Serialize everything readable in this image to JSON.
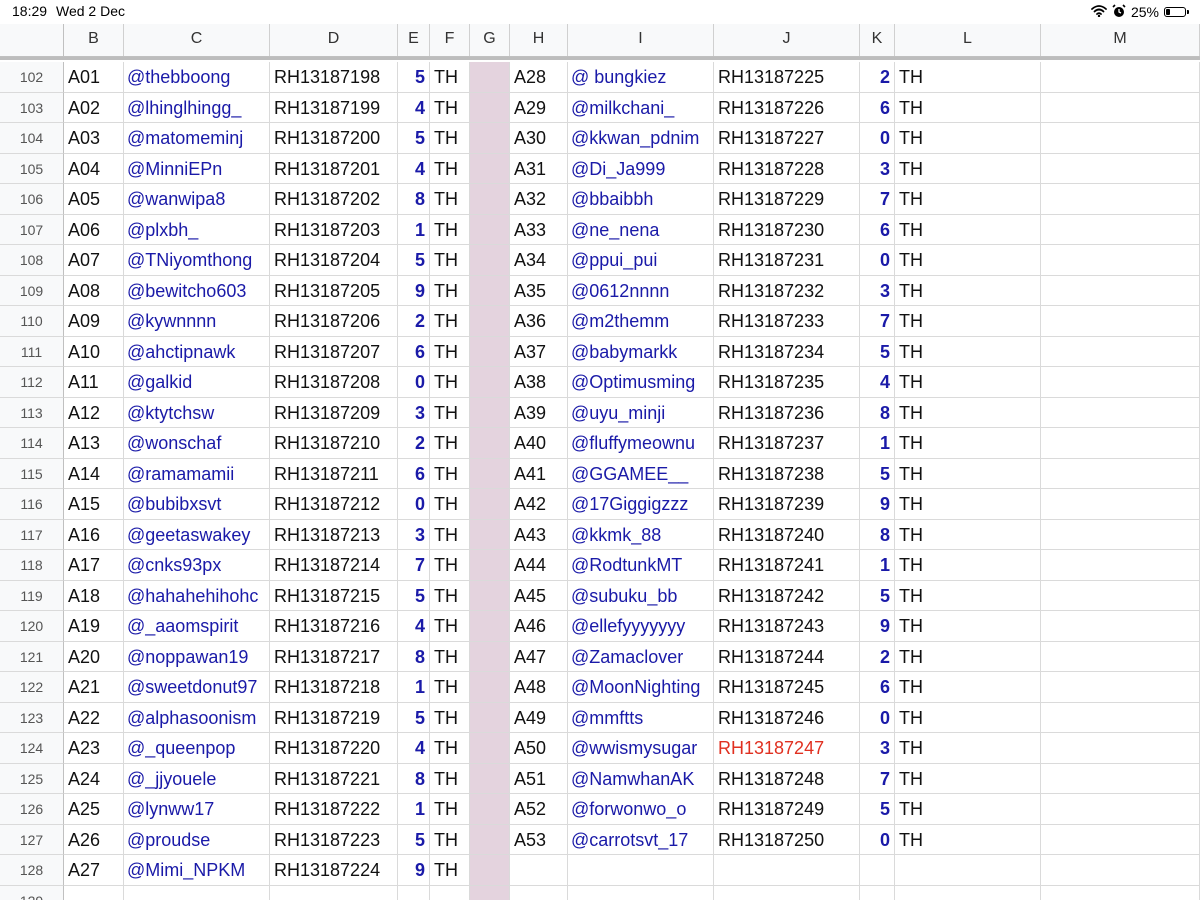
{
  "status_bar": {
    "time": "18:29",
    "date": "Wed 2 Dec",
    "battery": "25%",
    "battery_level": 0.25,
    "icons": [
      "wifi-icon",
      "alarm-icon",
      "battery-icon"
    ]
  },
  "colors": {
    "handle_text": "#1a1aa8",
    "highlight_text": "#e03020",
    "g_column_fill": "#e4d3de"
  },
  "columns": [
    "B",
    "C",
    "D",
    "E",
    "F",
    "G",
    "H",
    "I",
    "J",
    "K",
    "L",
    "M"
  ],
  "rows": [
    {
      "n": "102",
      "b": "A01",
      "c": "@thebboong",
      "d": "RH13187198",
      "e": "5",
      "f": "TH",
      "h": "A28",
      "i": "@ bungkiez",
      "j": "RH13187225",
      "k": "2",
      "l": "TH"
    },
    {
      "n": "103",
      "b": "A02",
      "c": "@lhinglhingg_",
      "d": "RH13187199",
      "e": "4",
      "f": "TH",
      "h": "A29",
      "i": "@milkchani_",
      "j": "RH13187226",
      "k": "6",
      "l": "TH"
    },
    {
      "n": "104",
      "b": "A03",
      "c": "@matomeminj",
      "d": "RH13187200",
      "e": "5",
      "f": "TH",
      "h": "A30",
      "i": "@kkwan_pdnim",
      "j": "RH13187227",
      "k": "0",
      "l": "TH"
    },
    {
      "n": "105",
      "b": "A04",
      "c": "@MinniEPn",
      "d": "RH13187201",
      "e": "4",
      "f": "TH",
      "h": "A31",
      "i": "@Di_Ja999",
      "j": "RH13187228",
      "k": "3",
      "l": "TH"
    },
    {
      "n": "106",
      "b": "A05",
      "c": "@wanwipa8",
      "d": "RH13187202",
      "e": "8",
      "f": "TH",
      "h": "A32",
      "i": "@bbaibbh",
      "j": "RH13187229",
      "k": "7",
      "l": "TH"
    },
    {
      "n": "107",
      "b": "A06",
      "c": "@plxbh_",
      "d": "RH13187203",
      "e": "1",
      "f": "TH",
      "h": "A33",
      "i": "@ne_nena",
      "j": "RH13187230",
      "k": "6",
      "l": "TH"
    },
    {
      "n": "108",
      "b": "A07",
      "c": "@TNiyomthong",
      "d": "RH13187204",
      "e": "5",
      "f": "TH",
      "h": "A34",
      "i": "@ppui_pui",
      "j": "RH13187231",
      "k": "0",
      "l": "TH"
    },
    {
      "n": "109",
      "b": "A08",
      "c": "@bewitcho603",
      "d": "RH13187205",
      "e": "9",
      "f": "TH",
      "h": "A35",
      "i": "@0612nnnn",
      "j": "RH13187232",
      "k": "3",
      "l": "TH"
    },
    {
      "n": "110",
      "b": "A09",
      "c": "@kywnnnn",
      "d": "RH13187206",
      "e": "2",
      "f": "TH",
      "h": "A36",
      "i": "@m2themm",
      "j": "RH13187233",
      "k": "7",
      "l": "TH"
    },
    {
      "n": "111",
      "b": "A10",
      "c": "@ahctipnawk",
      "d": "RH13187207",
      "e": "6",
      "f": "TH",
      "h": "A37",
      "i": "@babymarkk",
      "j": "RH13187234",
      "k": "5",
      "l": "TH"
    },
    {
      "n": "112",
      "b": "A11",
      "c": "@galkid",
      "d": "RH13187208",
      "e": "0",
      "f": "TH",
      "h": "A38",
      "i": "@Optimusming",
      "j": "RH13187235",
      "k": "4",
      "l": "TH"
    },
    {
      "n": "113",
      "b": "A12",
      "c": "@ktytchsw",
      "d": "RH13187209",
      "e": "3",
      "f": "TH",
      "h": "A39",
      "i": "@uyu_minji",
      "j": "RH13187236",
      "k": "8",
      "l": "TH"
    },
    {
      "n": "114",
      "b": "A13",
      "c": "@wonschaf",
      "d": "RH13187210",
      "e": "2",
      "f": "TH",
      "h": "A40",
      "i": "@fluffymeownu",
      "j": "RH13187237",
      "k": "1",
      "l": "TH"
    },
    {
      "n": "115",
      "b": "A14",
      "c": "@ramamamii",
      "d": "RH13187211",
      "e": "6",
      "f": "TH",
      "h": "A41",
      "i": "@GGAMEE__",
      "j": "RH13187238",
      "k": "5",
      "l": "TH"
    },
    {
      "n": "116",
      "b": "A15",
      "c": "@bubibxsvt",
      "d": "RH13187212",
      "e": "0",
      "f": "TH",
      "h": "A42",
      "i": "@17Giggigzzz",
      "j": "RH13187239",
      "k": "9",
      "l": "TH"
    },
    {
      "n": "117",
      "b": "A16",
      "c": "@geetaswakey",
      "d": "RH13187213",
      "e": "3",
      "f": "TH",
      "h": "A43",
      "i": "@kkmk_88",
      "j": "RH13187240",
      "k": "8",
      "l": "TH"
    },
    {
      "n": "118",
      "b": "A17",
      "c": "@cnks93px",
      "d": "RH13187214",
      "e": "7",
      "f": "TH",
      "h": "A44",
      "i": "@RodtunkMT",
      "j": "RH13187241",
      "k": "1",
      "l": "TH"
    },
    {
      "n": "119",
      "b": "A18",
      "c": "@hahahehihohc",
      "d": "RH13187215",
      "e": "5",
      "f": "TH",
      "h": "A45",
      "i": "@subuku_bb",
      "j": "RH13187242",
      "k": "5",
      "l": "TH"
    },
    {
      "n": "120",
      "b": "A19",
      "c": "@_aaomspirit",
      "d": "RH13187216",
      "e": "4",
      "f": "TH",
      "h": "A46",
      "i": "@ellefyyyyyyy",
      "j": "RH13187243",
      "k": "9",
      "l": "TH"
    },
    {
      "n": "121",
      "b": "A20",
      "c": "@noppawan19",
      "d": "RH13187217",
      "e": "8",
      "f": "TH",
      "h": "A47",
      "i": "@Zamaclover",
      "j": "RH13187244",
      "k": "2",
      "l": "TH"
    },
    {
      "n": "122",
      "b": "A21",
      "c": "@sweetdonut97",
      "d": "RH13187218",
      "e": "1",
      "f": "TH",
      "h": "A48",
      "i": "@MoonNighting",
      "j": "RH13187245",
      "k": "6",
      "l": "TH"
    },
    {
      "n": "123",
      "b": "A22",
      "c": "@alphasoonism",
      "d": "RH13187219",
      "e": "5",
      "f": "TH",
      "h": "A49",
      "i": "@mmftts",
      "j": "RH13187246",
      "k": "0",
      "l": "TH"
    },
    {
      "n": "124",
      "b": "A23",
      "c": "@_queenpop",
      "d": "RH13187220",
      "e": "4",
      "f": "TH",
      "h": "A50",
      "i": "@wwismysugar",
      "j": "RH13187247",
      "k": "3",
      "l": "TH",
      "j_highlight": true
    },
    {
      "n": "125",
      "b": "A24",
      "c": "@_jjyouele",
      "d": "RH13187221",
      "e": "8",
      "f": "TH",
      "h": "A51",
      "i": "@NamwhanAK",
      "j": "RH13187248",
      "k": "7",
      "l": "TH"
    },
    {
      "n": "126",
      "b": "A25",
      "c": "@lynww17",
      "d": "RH13187222",
      "e": "1",
      "f": "TH",
      "h": "A52",
      "i": "@forwonwo_o",
      "j": "RH13187249",
      "k": "5",
      "l": "TH"
    },
    {
      "n": "127",
      "b": "A26",
      "c": "@proudse",
      "d": "RH13187223",
      "e": "5",
      "f": "TH",
      "h": "A53",
      "i": "@carrotsvt_17",
      "j": "RH13187250",
      "k": "0",
      "l": "TH"
    },
    {
      "n": "128",
      "b": "A27",
      "c": "@Mimi_NPKM",
      "d": "RH13187224",
      "e": "9",
      "f": "TH",
      "h": "",
      "i": "",
      "j": "",
      "k": "",
      "l": ""
    },
    {
      "n": "129",
      "b": "",
      "c": "",
      "d": "",
      "e": "",
      "f": "",
      "h": "",
      "i": "",
      "j": "",
      "k": "",
      "l": ""
    }
  ]
}
